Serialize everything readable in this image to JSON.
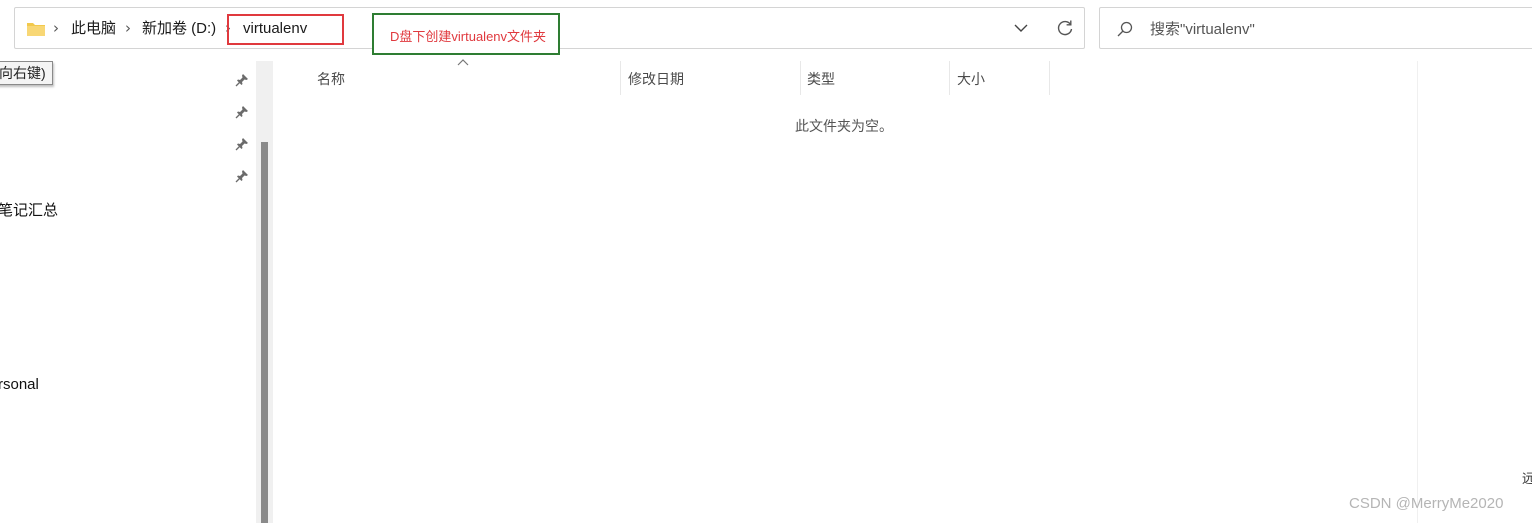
{
  "address_bar": {
    "breadcrumbs": [
      "此电脑",
      "新加卷 (D:)",
      "virtualenv"
    ]
  },
  "annotation": {
    "text": "D盘下创建virtualenv文件夹",
    "box_color": "#2e7d32",
    "text_color": "#e0393e",
    "highlight_color": "#e0393e"
  },
  "search": {
    "placeholder": "搜索\"virtualenv\""
  },
  "nav_pane": {
    "tooltip": "向右键)",
    "items": [
      "笔记汇总",
      "rsonal"
    ]
  },
  "file_list": {
    "columns": [
      "名称",
      "修改日期",
      "类型",
      "大小"
    ],
    "empty_message": "此文件夹为空。"
  },
  "edge_text": "远",
  "watermark": "CSDN @MerryMe2020",
  "icons": [
    "folder-icon",
    "chevron-right-icon",
    "chevron-down-icon",
    "refresh-icon",
    "search-icon",
    "pin-icon",
    "sort-ascending-icon"
  ]
}
